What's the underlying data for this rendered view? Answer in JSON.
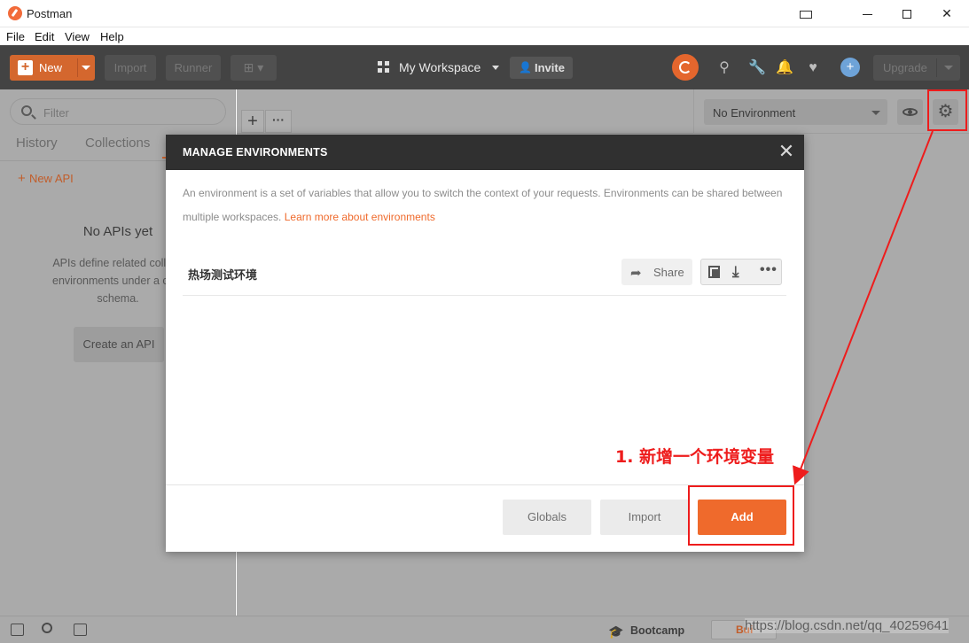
{
  "window": {
    "title": "Postman",
    "controls": [
      "minimize",
      "maximize",
      "close"
    ]
  },
  "menu": [
    "File",
    "Edit",
    "View",
    "Help"
  ],
  "header": {
    "new_label": "New",
    "import_label": "Import",
    "runner_label": "Runner",
    "workspace_label": "My Workspace",
    "invite_label": "Invite",
    "upgrade_label": "Upgrade"
  },
  "sidebar": {
    "filter_placeholder": "Filter",
    "tabs": [
      "History",
      "Collections"
    ],
    "new_api_label": "New API",
    "empty_title": "No APIs yet",
    "empty_desc_lines": [
      "APIs define related collecti",
      "environments under a com",
      "schema."
    ],
    "create_api_label": "Create an API"
  },
  "environment": {
    "selected": "No Environment"
  },
  "modal": {
    "title": "MANAGE ENVIRONMENTS",
    "description": "An environment is a set of variables that allow you to switch the context of your requests. Environments can be shared between multiple workspaces.",
    "learn_more": "Learn more about environments",
    "environments": [
      {
        "name": "热场测试环境",
        "share_label": "Share"
      }
    ],
    "buttons": {
      "globals": "Globals",
      "import": "Import",
      "add": "Add"
    }
  },
  "footer": {
    "bootcamp_label": "Bootcamp",
    "build_label": "Bui",
    "watermark": "https://blog.csdn.net/qq_40259641"
  },
  "annotation": {
    "text": "1. 新增一个环境变量",
    "color": "#ee1c1c"
  },
  "colors": {
    "accent": "#ef6a2c",
    "header_bg": "#434343",
    "modal_header_bg": "#303030"
  }
}
